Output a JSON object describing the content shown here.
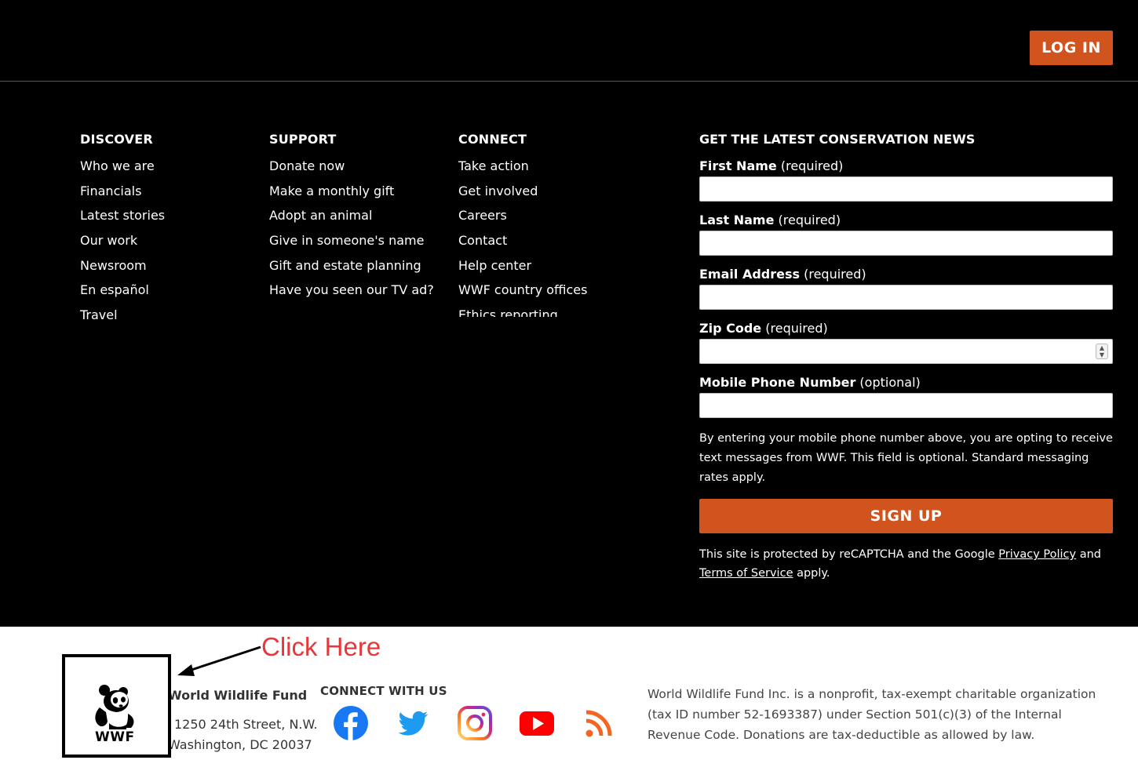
{
  "header": {
    "login_label": "LOG IN"
  },
  "discover": {
    "title": "DISCOVER",
    "items": [
      "Who we are",
      "Financials",
      "Latest stories",
      "Our work",
      "Newsroom",
      "En español",
      "Travel"
    ]
  },
  "support": {
    "title": "SUPPORT",
    "items": [
      "Donate now",
      "Make a monthly gift",
      "Adopt an animal",
      "Give in someone's name",
      "Gift and estate planning",
      "Have you seen our TV ad?"
    ]
  },
  "connect": {
    "title": "CONNECT",
    "items": [
      "Take action",
      "Get involved",
      "Careers",
      "Contact",
      "Help center",
      "WWF country offices",
      "Ethics reporting"
    ]
  },
  "newsletter": {
    "title": "GET THE LATEST CONSERVATION NEWS",
    "first_name": {
      "label": "First Name",
      "note": "(required)",
      "value": ""
    },
    "last_name": {
      "label": "Last Name",
      "note": "(required)",
      "value": ""
    },
    "email": {
      "label": "Email Address",
      "note": "(required)",
      "value": ""
    },
    "zip": {
      "label": "Zip Code",
      "note": "(required)",
      "value": ""
    },
    "phone": {
      "label": "Mobile Phone Number",
      "note": "(optional)",
      "value": ""
    },
    "disclaimer": "By entering your mobile phone number above, you are opting to receive text messages from WWF. This field is optional. Standard messaging rates apply.",
    "signup_label": "SIGN UP",
    "recaptcha_prefix": "This site is protected by reCAPTCHA and the Google ",
    "privacy_link": "Privacy Policy",
    "recaptcha_and": " and ",
    "terms_link": "Terms of Service",
    "recaptcha_suffix": " apply."
  },
  "footer": {
    "logo_text": "WWF",
    "org_name": "World Wildlife Fund",
    "street": "1250 24th Street, N.W.",
    "city": "Washington, DC 20037",
    "connect_title": "CONNECT WITH US",
    "social_icons": [
      "facebook-icon",
      "twitter-icon",
      "instagram-icon",
      "youtube-icon",
      "rss-icon"
    ],
    "legal": "World Wildlife Fund Inc. is a nonprofit, tax-exempt charitable organization (tax ID number 52-1693387) under Section 501(c)(3) of the Internal Revenue Code. Donations are tax-deductible as allowed by law."
  },
  "annotation": {
    "callout_text": "Click Here",
    "callout_color": "#e8373a"
  },
  "colors": {
    "accent": "#d1541e",
    "facebook": "#1877f2",
    "twitter": "#1d9bf0",
    "youtube": "#ff0000",
    "rss": "#f26522"
  }
}
